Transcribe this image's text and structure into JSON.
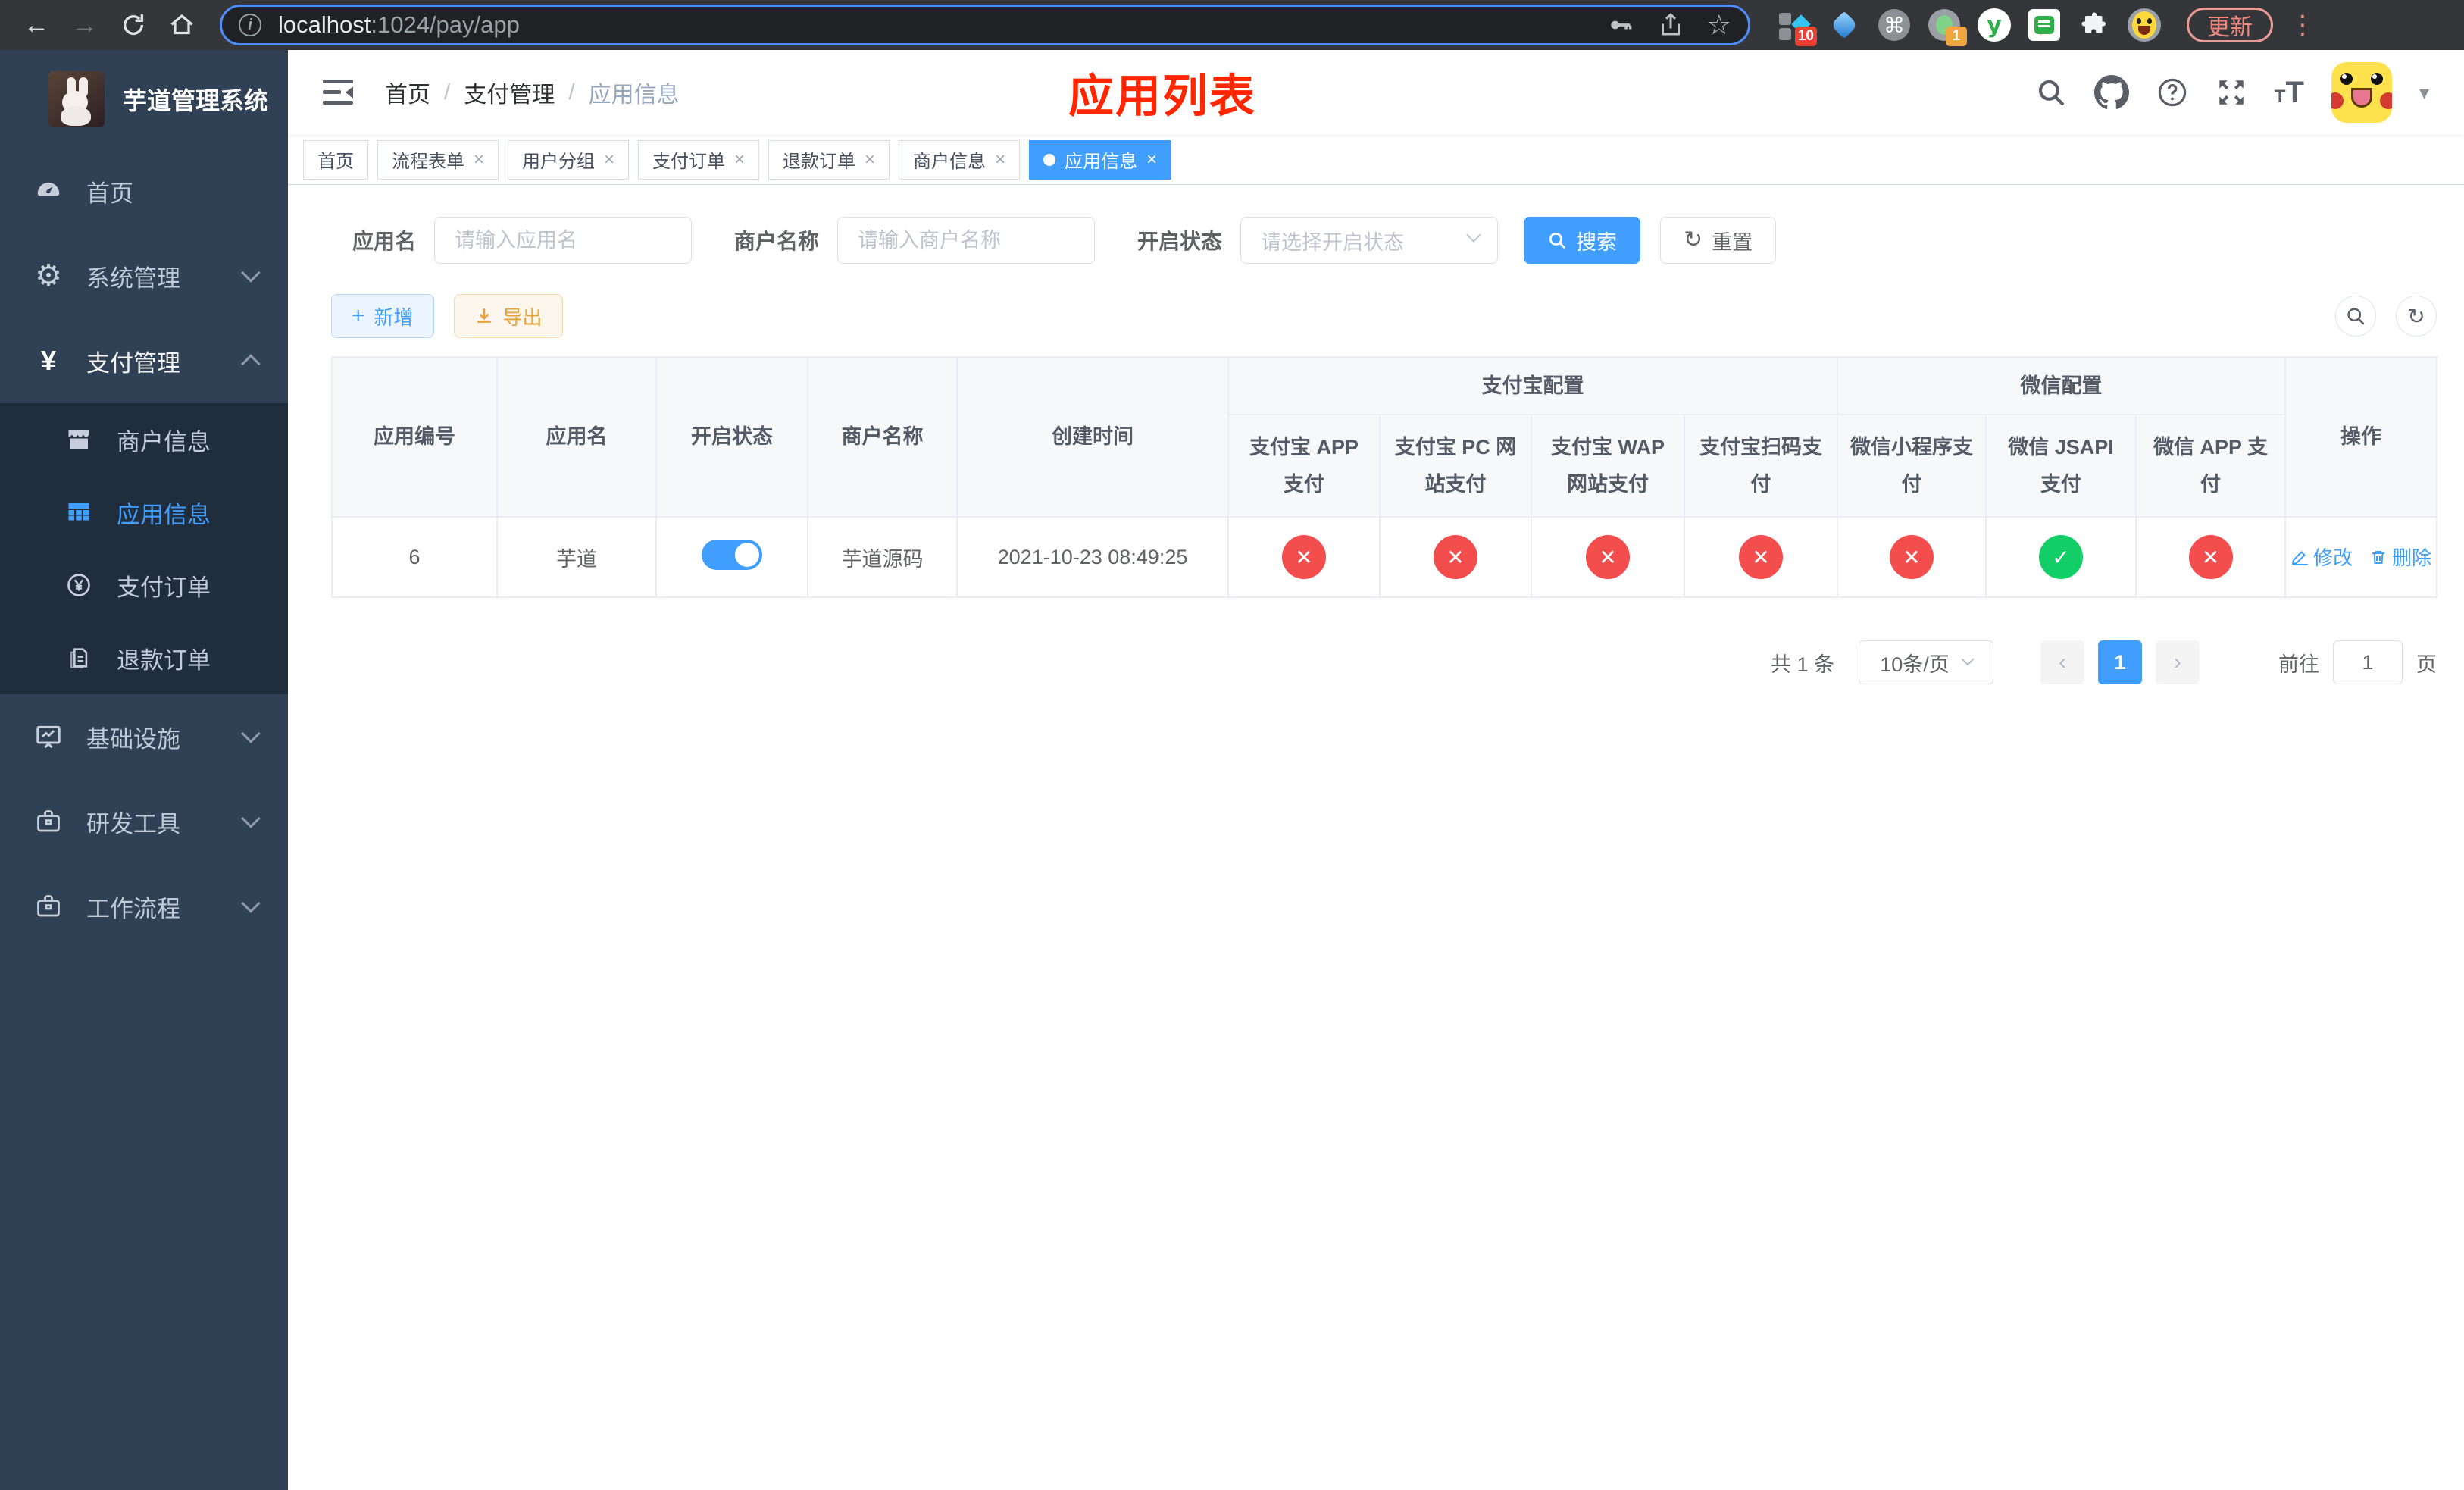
{
  "colors": {
    "accent": "#409eff",
    "enabled_green": "#13ce66",
    "disabled_red": "#f34d4d",
    "title_red": "#ff2600"
  },
  "browser": {
    "url_host": "localhost",
    "url_rest": ":1024/pay/app",
    "update_button": "更新",
    "extension_badge_scripts": "10",
    "extension_badge_proxy": "1"
  },
  "sidebar": {
    "title": "芋道管理系统",
    "menu_top": [
      {
        "label": "首页"
      },
      {
        "label": "系统管理"
      },
      {
        "label": "支付管理"
      }
    ],
    "submenu": [
      {
        "label": "商户信息"
      },
      {
        "label": "应用信息"
      },
      {
        "label": "支付订单"
      },
      {
        "label": "退款订单"
      }
    ],
    "menu_bottom": [
      {
        "label": "基础设施"
      },
      {
        "label": "研发工具"
      },
      {
        "label": "工作流程"
      }
    ]
  },
  "navbar": {
    "breadcrumb": [
      "首页",
      "支付管理",
      "应用信息"
    ],
    "page_title": "应用列表"
  },
  "tabs": [
    {
      "label": "首页"
    },
    {
      "label": "流程表单"
    },
    {
      "label": "用户分组"
    },
    {
      "label": "支付订单"
    },
    {
      "label": "退款订单"
    },
    {
      "label": "商户信息"
    },
    {
      "label": "应用信息"
    }
  ],
  "filters": {
    "app_name_label": "应用名",
    "app_name_placeholder": "请输入应用名",
    "merchant_label": "商户名称",
    "merchant_placeholder": "请输入商户名称",
    "status_label": "开启状态",
    "status_placeholder": "请选择开启状态",
    "search_button": "搜索",
    "reset_button": "重置"
  },
  "toolbar": {
    "add_button": "新增",
    "export_button": "导出"
  },
  "table": {
    "headers": {
      "app_id": "应用编号",
      "app_name": "应用名",
      "status": "开启状态",
      "merchant": "商户名称",
      "created": "创建时间",
      "alipay_group": "支付宝配置",
      "wechat_group": "微信配置",
      "channels": [
        "支付宝 APP 支付",
        "支付宝 PC 网站支付",
        "支付宝 WAP 网站支付",
        "支付宝扫码支付",
        "微信小程序支付",
        "微信 JSAPI 支付",
        "微信 APP 支付"
      ],
      "operation": "操作"
    },
    "row": {
      "id": "6",
      "name": "芋道",
      "enabled": true,
      "merchant": "芋道源码",
      "created": "2021-10-23 08:49:25",
      "channels": [
        false,
        false,
        false,
        false,
        false,
        true,
        false
      ],
      "edit_label": "修改",
      "delete_label": "删除"
    }
  },
  "pagination": {
    "total": "共 1 条",
    "per_page": "10条/页",
    "page": "1",
    "goto_label": "前往",
    "goto_value": "1",
    "page_suffix": "页"
  }
}
